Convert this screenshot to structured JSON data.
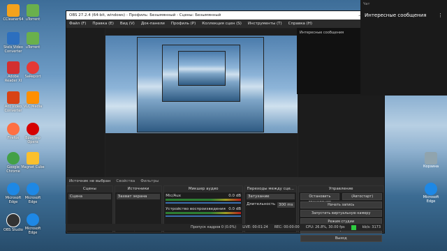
{
  "desktop_icons": [
    {
      "label": "CCleaner64",
      "color": "#f4a21c"
    },
    {
      "label": "uTorrent",
      "color": "#6ab04c"
    },
    {
      "label": "Stels Video Converter",
      "color": "#2c6fbf"
    },
    {
      "label": "uTorrent",
      "color": "#6ab04c"
    },
    {
      "label": "Adobe Reader XI",
      "color": "#d32f2f"
    },
    {
      "label": "SaReport",
      "color": "#e53935"
    },
    {
      "label": "Ant Video Converter",
      "color": "#d84315"
    },
    {
      "label": "VLC Media",
      "color": "#ff8f00"
    },
    {
      "label": "Firefox",
      "color": "#ff7043"
    },
    {
      "label": "Браузер Opera",
      "color": "#d50000"
    },
    {
      "label": "Google Chrome",
      "color": "#43a047"
    },
    {
      "label": "Magnet Cube",
      "color": "#fbc02d"
    },
    {
      "label": "Microsoft Edge",
      "color": "#1e88e5"
    },
    {
      "label": "Microsoft Edge",
      "color": "#1e88e5"
    },
    {
      "label": "OBS Studio",
      "color": "#333333"
    },
    {
      "label": "Microsoft Edge",
      "color": "#1e88e5"
    }
  ],
  "obs": {
    "title": "OBS 27.2.4 (64-bit, windows) - Профиль: Безымянный - Сцены: Безымянный",
    "menu": [
      "Файл (F)",
      "Правка (E)",
      "Вид (V)",
      "Док-панели",
      "Профиль (P)",
      "Коллекция сцен (S)",
      "Инструменты (T)",
      "Справка (H)"
    ],
    "chat_popup_title": "Интересные сообщения",
    "status_line": {
      "none_selected": "Источник не выбран",
      "properties": "Свойства",
      "filters": "Фильтры"
    },
    "docks": {
      "scenes": {
        "header": "Сцены",
        "items": [
          "Сцена"
        ]
      },
      "sources": {
        "header": "Источники",
        "items": [
          "Захват экрана"
        ]
      },
      "mixer": {
        "header": "Микшер аудио",
        "channels": [
          {
            "name": "Mic/Aux",
            "db": "0.0 dB"
          },
          {
            "name": "Устройство воспроизведения",
            "db": "0.0 dB"
          }
        ]
      },
      "transitions": {
        "header": "Переходы между сце...",
        "type": "Затухание",
        "duration_label": "Длительность",
        "duration": "300 ms"
      },
      "controls": {
        "header": "Управление",
        "buttons": [
          "Остановить трансляцию",
          "(Автостарт)",
          "Начать запись",
          "Запустить виртуальную камеру",
          "Режим студии",
          "Настройки",
          "Выход"
        ]
      }
    },
    "footer": {
      "dropped": "Пропуск кадров 0 (0.0%)",
      "live": "LIVE: 00:01:24",
      "rec": "REC: 00:00:00",
      "cpu": "CPU: 26.8%, 30.00 fps",
      "kbps": "kb/s: 3173"
    }
  },
  "notifications": {
    "small": "Чат",
    "title": "Интересные сообщения"
  },
  "right_icons": [
    {
      "label": "Корзина",
      "color": "#90a4ae"
    },
    {
      "label": "Microsoft Edge",
      "color": "#1e88e5"
    }
  ]
}
